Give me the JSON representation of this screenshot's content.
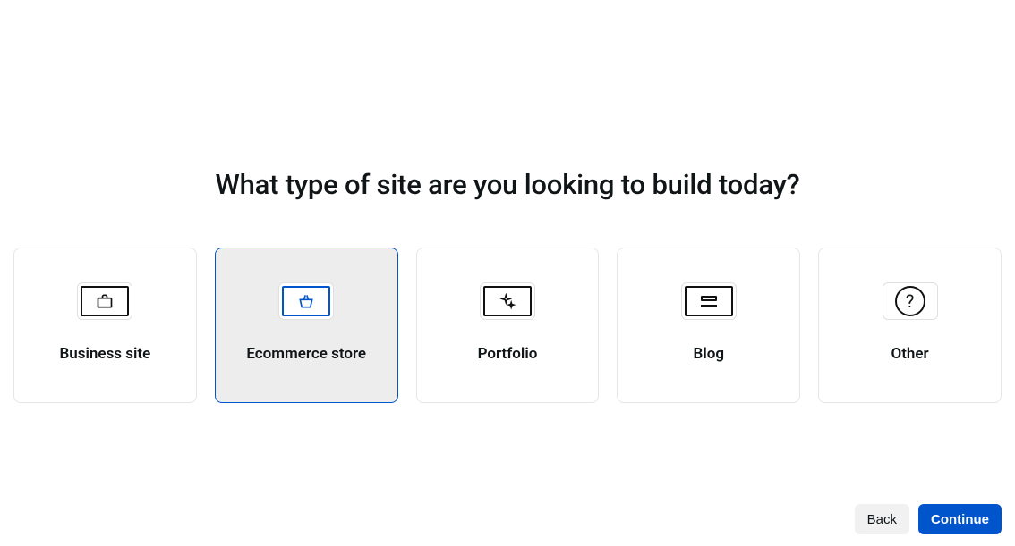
{
  "heading": "What type of site are you looking to build today?",
  "options": [
    {
      "label": "Business site",
      "icon": "briefcase-icon",
      "selected": false
    },
    {
      "label": "Ecommerce store",
      "icon": "basket-icon",
      "selected": true
    },
    {
      "label": "Portfolio",
      "icon": "sparkle-icon",
      "selected": false
    },
    {
      "label": "Blog",
      "icon": "post-icon",
      "selected": false
    },
    {
      "label": "Other",
      "icon": "question-icon",
      "selected": false
    }
  ],
  "actions": {
    "back": "Back",
    "continue": "Continue"
  }
}
